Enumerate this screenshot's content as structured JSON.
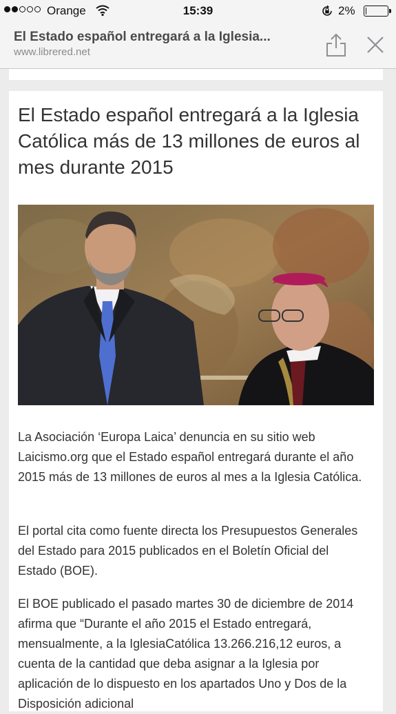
{
  "status_bar": {
    "signal_filled": 2,
    "signal_total": 5,
    "carrier": "Orange",
    "time": "15:39",
    "battery_percent": "2%",
    "battery_level": 0.02,
    "icons": [
      "wifi-icon",
      "rotation-lock-icon",
      "battery-icon"
    ]
  },
  "browser": {
    "page_title": "El Estado español entregará a la Iglesia...",
    "domain": "www.librered.net",
    "share_icon": "share-icon",
    "close_icon": "close-icon"
  },
  "article": {
    "headline": "El Estado español entregará a la Iglesia Católica más de 13 millones de euros al mes durante 2015",
    "paragraphs": [
      "La Asociación ‘Europa Laica’ denuncia en su sitio web Laicismo.org que el Estado español entregará durante el año 2015 más de 13 millones de euros al mes a la Iglesia Católica.",
      "El portal cita como fuente directa los Presupuestos Generales del Estado para 2015 publicados en el Boletín Oficial del Estado (BOE).",
      "El BOE publicado el pasado martes 30 de diciembre de 2014 afirma que “Durante el año 2015 el Estado entregará, mensualmente, a la IglesiaCatólica 13.266.216,12 euros, a cuenta de la cantidad que deba asignar a la Iglesia por aplicación de lo dispuesto en los apartados Uno y Dos de la Disposición adicional"
    ]
  },
  "colors": {
    "status_bg": "#f4f4f5",
    "page_bg": "#ececec",
    "card_bg": "#ffffff",
    "text": "#333333",
    "muted": "#8a8a8a"
  }
}
